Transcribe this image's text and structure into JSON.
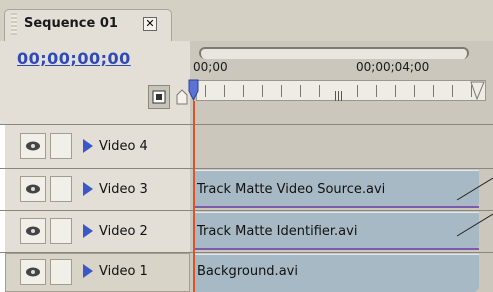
{
  "tab": {
    "title": "Sequence 01",
    "close_glyph": "✕"
  },
  "timecode": {
    "current": "00;00;00;00"
  },
  "ruler": {
    "labels": [
      "00;00",
      "00;00;04;00"
    ]
  },
  "tracks": [
    {
      "name": "Video 4",
      "clip": ""
    },
    {
      "name": "Video 3",
      "clip": "Track Matte Video Source.avi"
    },
    {
      "name": "Video 2",
      "clip": "Track Matte Identifier.avi"
    },
    {
      "name": "Video 1",
      "clip": "Background.avi"
    }
  ],
  "colors": {
    "accent": "#2f49b6",
    "cti": "#d4562a",
    "clip": "#a7b9c4",
    "panel": "#e3dfd6"
  },
  "icons": [
    "eye-icon",
    "snap-icon",
    "marker-icon",
    "expand-triangle-icon",
    "close-icon"
  ]
}
